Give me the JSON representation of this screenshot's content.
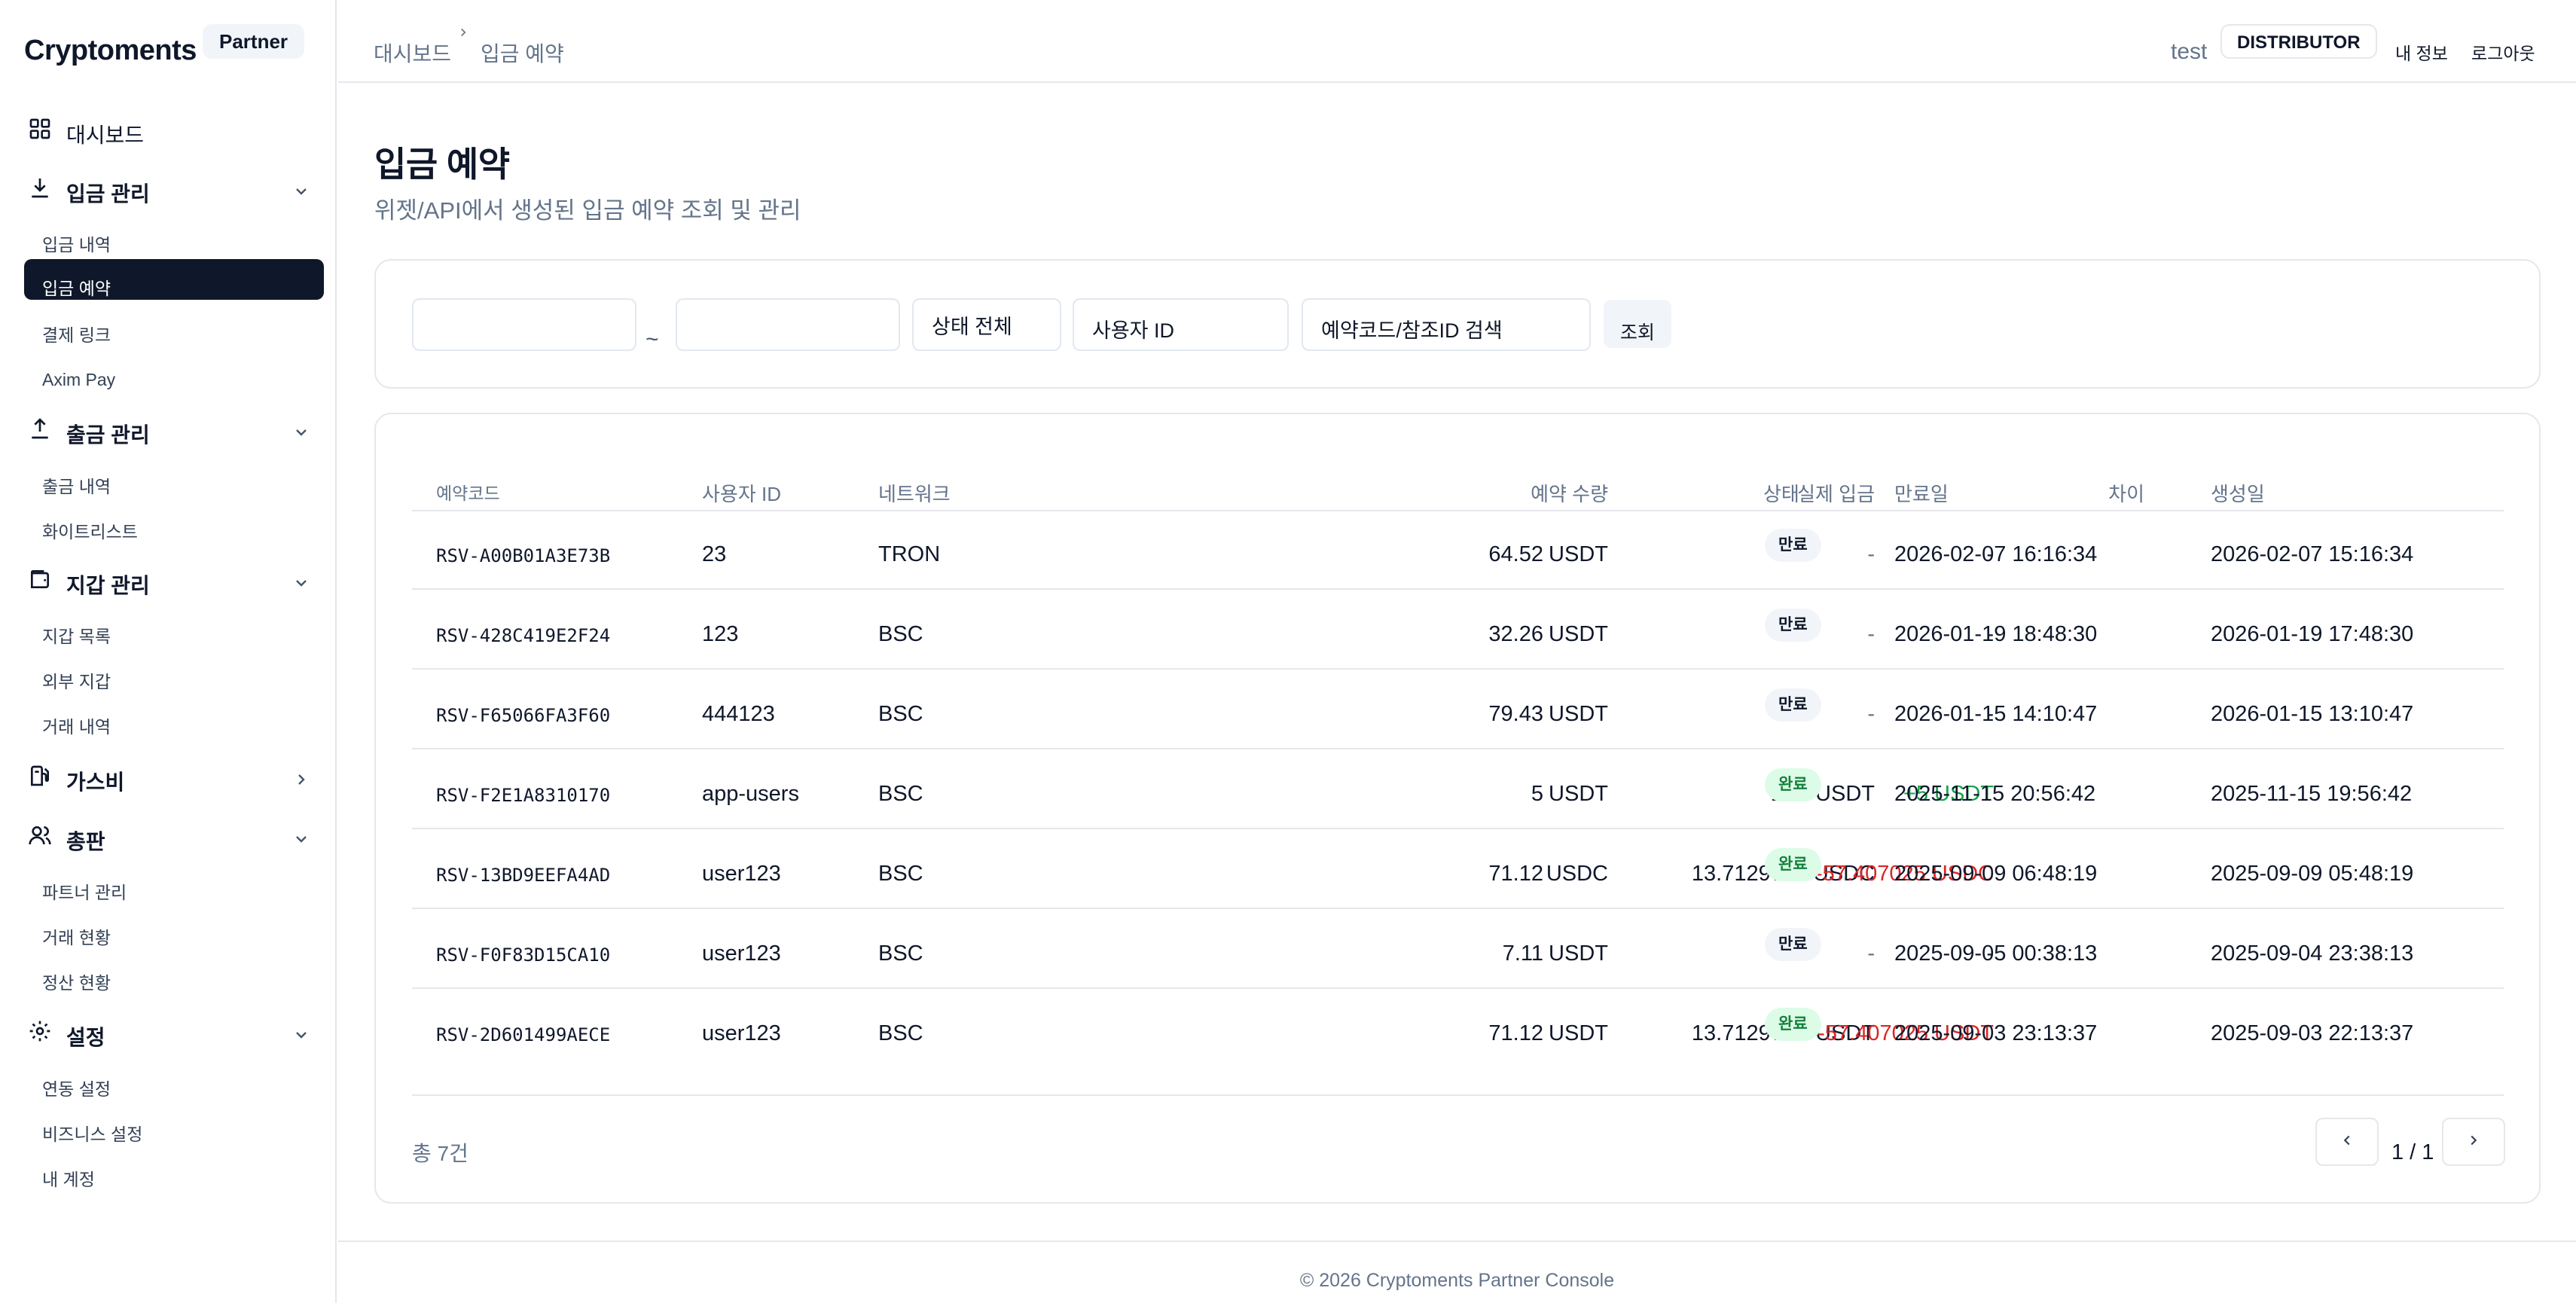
{
  "brand": {
    "name": "Cryptoments",
    "badge": "Partner"
  },
  "sidebar": {
    "dashboard": "대시보드",
    "deposit": {
      "label": "입금 관리",
      "items": [
        "입금 내역",
        "입금 예약",
        "결제 링크",
        "Axim Pay"
      ]
    },
    "withdraw": {
      "label": "출금 관리",
      "items": [
        "출금 내역",
        "화이트리스트"
      ]
    },
    "wallet": {
      "label": "지갑 관리",
      "items": [
        "지갑 목록",
        "외부 지갑",
        "거래 내역"
      ]
    },
    "gas": {
      "label": "가스비"
    },
    "reseller": {
      "label": "총판",
      "items": [
        "파트너 관리",
        "거래 현황",
        "정산 현황"
      ]
    },
    "settings": {
      "label": "설정",
      "items": [
        "연동 설정",
        "비즈니스 설정",
        "내 계정"
      ]
    }
  },
  "breadcrumb": {
    "root": "대시보드",
    "current": "입금 예약"
  },
  "header": {
    "user": "test",
    "role": "DISTRIBUTOR",
    "my_info": "내 정보",
    "logout": "로그아웃"
  },
  "page": {
    "title": "입금 예약",
    "subtitle": "위젯/API에서 생성된 입금 예약 조회 및 관리"
  },
  "filters": {
    "date_from": "",
    "date_to": "",
    "separator": "~",
    "status": "상태 전체",
    "user_id_placeholder": "사용자 ID",
    "search_placeholder": "예약코드/참조ID 검색",
    "search_button": "조회"
  },
  "table": {
    "columns": [
      "예약코드",
      "사용자 ID",
      "네트워크",
      "예약 수량",
      "실제 입금",
      "차이",
      "상태",
      "만료일",
      "생성일"
    ],
    "rows": [
      {
        "code": "RSV-A00B01A3E73B",
        "user": "23",
        "network": "TRON",
        "amount": "64.52",
        "amount_unit": "USDT",
        "actual": "-",
        "actual_unit": "",
        "diff": "-",
        "diff_type": "none",
        "status": "만료",
        "status_type": "expired",
        "expires": "2026-02-07 16:16:34",
        "created": "2026-02-07 15:16:34"
      },
      {
        "code": "RSV-428C419E2F24",
        "user": "123",
        "network": "BSC",
        "amount": "32.26",
        "amount_unit": "USDT",
        "actual": "-",
        "actual_unit": "",
        "diff": "-",
        "diff_type": "none",
        "status": "만료",
        "status_type": "expired",
        "expires": "2026-01-19 18:48:30",
        "created": "2026-01-19 17:48:30"
      },
      {
        "code": "RSV-F65066FA3F60",
        "user": "444123",
        "network": "BSC",
        "amount": "79.43",
        "amount_unit": "USDT",
        "actual": "-",
        "actual_unit": "",
        "diff": "-",
        "diff_type": "none",
        "status": "만료",
        "status_type": "expired",
        "expires": "2026-01-15 14:10:47",
        "created": "2026-01-15 13:10:47"
      },
      {
        "code": "RSV-F2E1A8310170",
        "user": "app-users",
        "network": "BSC",
        "amount": "5",
        "amount_unit": "USDT",
        "actual": "10",
        "actual_unit": "USDT",
        "diff": "+5 USDT",
        "diff_type": "pos",
        "status": "완료",
        "status_type": "done",
        "expires": "2025-11-15 20:56:42",
        "created": "2025-11-15 19:56:42"
      },
      {
        "code": "RSV-13BD9EEFA4AD",
        "user": "user123",
        "network": "BSC",
        "amount": "71.12",
        "amount_unit": "USDC",
        "actual": "13.712975",
        "actual_unit": "USDC",
        "diff": "-57.407025 USDC",
        "diff_type": "neg",
        "status": "완료",
        "status_type": "done",
        "expires": "2025-09-09 06:48:19",
        "created": "2025-09-09 05:48:19"
      },
      {
        "code": "RSV-F0F83D15CA10",
        "user": "user123",
        "network": "BSC",
        "amount": "7.11",
        "amount_unit": "USDT",
        "actual": "-",
        "actual_unit": "",
        "diff": "-",
        "diff_type": "none",
        "status": "만료",
        "status_type": "expired",
        "expires": "2025-09-05 00:38:13",
        "created": "2025-09-04 23:38:13"
      },
      {
        "code": "RSV-2D601499AECE",
        "user": "user123",
        "network": "BSC",
        "amount": "71.12",
        "amount_unit": "USDT",
        "actual": "13.712975",
        "actual_unit": "USDT",
        "diff": "-57.407025 USDT",
        "diff_type": "neg",
        "status": "완료",
        "status_type": "done",
        "expires": "2025-09-03 23:13:37",
        "created": "2025-09-03 22:13:37"
      }
    ]
  },
  "pagination": {
    "total": "총 7건",
    "page": "1 / 1"
  },
  "footer": "© 2026 Cryptoments Partner Console",
  "colors": {
    "primary": "#0f172a",
    "muted": "#64748b",
    "positive": "#16a34a",
    "negative": "#dc2626",
    "border": "#e5e7eb"
  }
}
